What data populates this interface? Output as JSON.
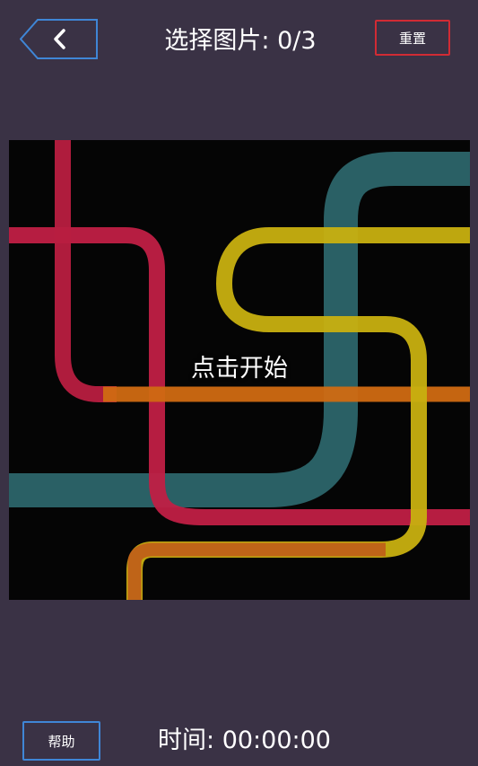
{
  "header": {
    "back_icon": "chevron-left-icon",
    "title": "选择图片: 0/3",
    "reset_label": "重置"
  },
  "board": {
    "start_label": "点击开始",
    "pipe_colors": {
      "red": "#c01f45",
      "orange": "#d06a12",
      "yellow": "#c8b010",
      "teal": "#2f6a70"
    }
  },
  "footer": {
    "help_label": "帮助",
    "timer": "时间: 00:00:00"
  },
  "colors": {
    "background": "#3a3245",
    "back_button_border": "#3f86d6",
    "reset_button_border": "#d12b34",
    "help_button_border": "#3f86d6"
  }
}
